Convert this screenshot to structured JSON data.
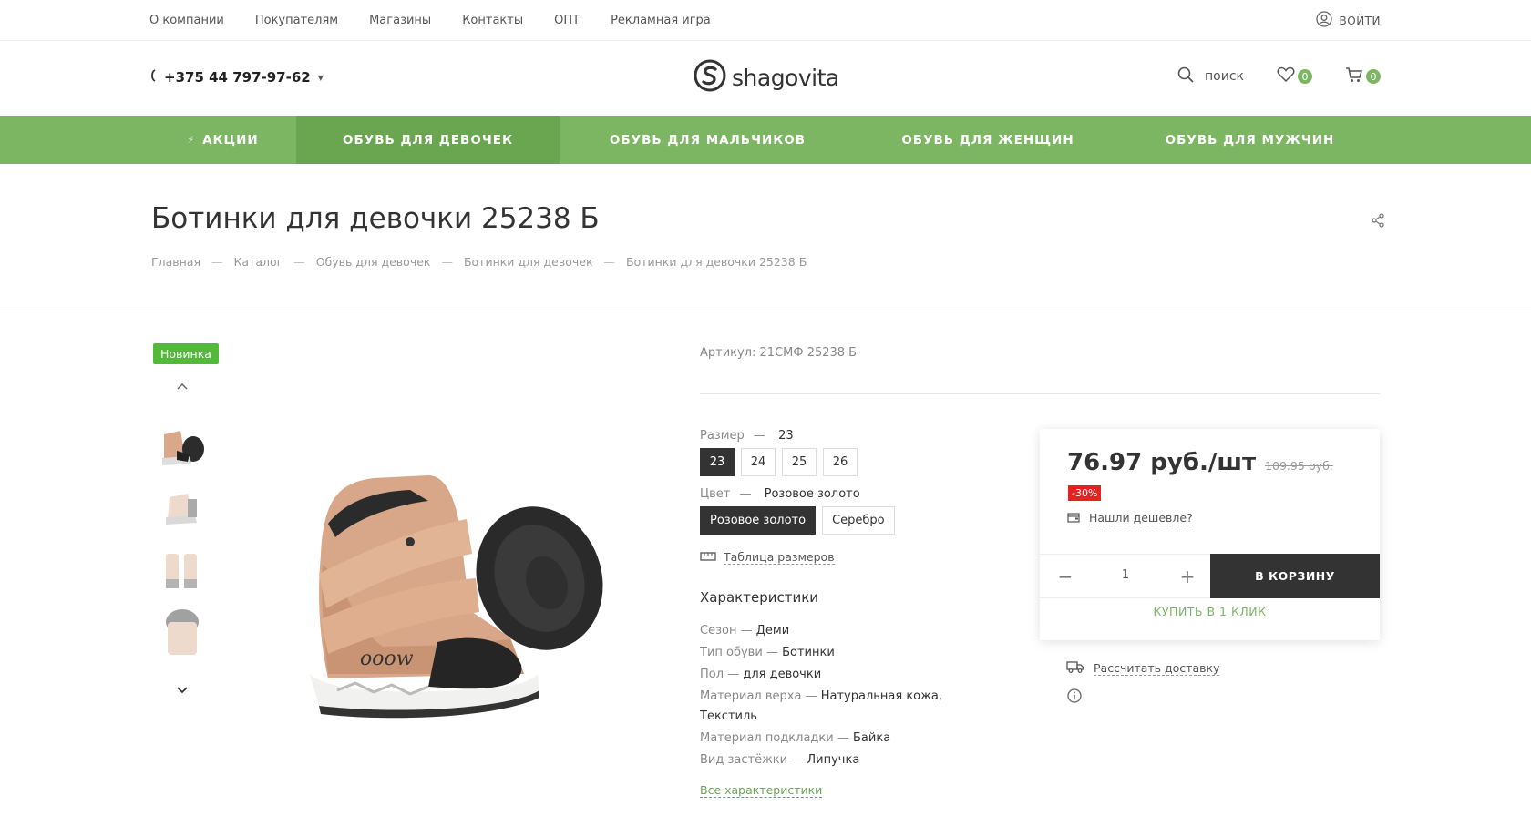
{
  "topbar": {
    "links": [
      "О компании",
      "Покупателям",
      "Магазины",
      "Контакты",
      "ОПТ",
      "Рекламная игра"
    ],
    "login_label": "ВОЙТИ"
  },
  "header": {
    "phone": "+375 44 797-97-62",
    "logo_text": "shagovita",
    "search_label": "поиск",
    "favorites_count": "0",
    "cart_count": "0"
  },
  "nav": {
    "items": [
      "АКЦИИ",
      "ОБУВЬ ДЛЯ ДЕВОЧЕК",
      "ОБУВЬ ДЛЯ МАЛЬЧИКОВ",
      "ОБУВЬ ДЛЯ ЖЕНЩИН",
      "ОБУВЬ ДЛЯ МУЖЧИН"
    ]
  },
  "page": {
    "title": "Ботинки для девочки 25238 Б",
    "breadcrumb": [
      "Главная",
      "Каталог",
      "Обувь для девочек",
      "Ботинки для девочек",
      "Ботинки для девочки 25238 Б"
    ],
    "breadcrumb_sep": "—"
  },
  "product": {
    "badge": "Новинка",
    "article": "Артикул: 21СМФ 25238 Б",
    "size_label": "Размер",
    "size_selected": "23",
    "sizes": [
      "23",
      "24",
      "25",
      "26"
    ],
    "color_label": "Цвет",
    "color_selected": "Розовое золото",
    "colors": [
      "Розовое золото",
      "Серебро"
    ],
    "size_table": "Таблица размеров",
    "chars_title": "Характеристики",
    "chars": [
      {
        "k": "Сезон",
        "v": "Деми"
      },
      {
        "k": "Тип обуви",
        "v": "Ботинки"
      },
      {
        "k": "Пол",
        "v": "для девочки"
      },
      {
        "k": "Материал верха",
        "v": "Натуральная кожа, Текстиль"
      },
      {
        "k": "Материал подкладки",
        "v": "Байка"
      },
      {
        "k": "Вид застёжки",
        "v": "Липучка"
      }
    ],
    "all_chars": "Все характеристики"
  },
  "buybox": {
    "price": "76.97 руб./шт",
    "old_price": "109.95 руб.",
    "discount": "-30%",
    "cheaper": "Нашли дешевле?",
    "quantity": "1",
    "cart_button": "В КОРЗИНУ",
    "one_click": "КУПИТЬ В 1 КЛИК",
    "delivery": "Рассчитать доставку"
  },
  "colors": {
    "accent": "#7db662",
    "accent_dark": "#6aa64f",
    "dark": "#333333",
    "discount": "#e52222",
    "badge_new": "#53b93a"
  }
}
